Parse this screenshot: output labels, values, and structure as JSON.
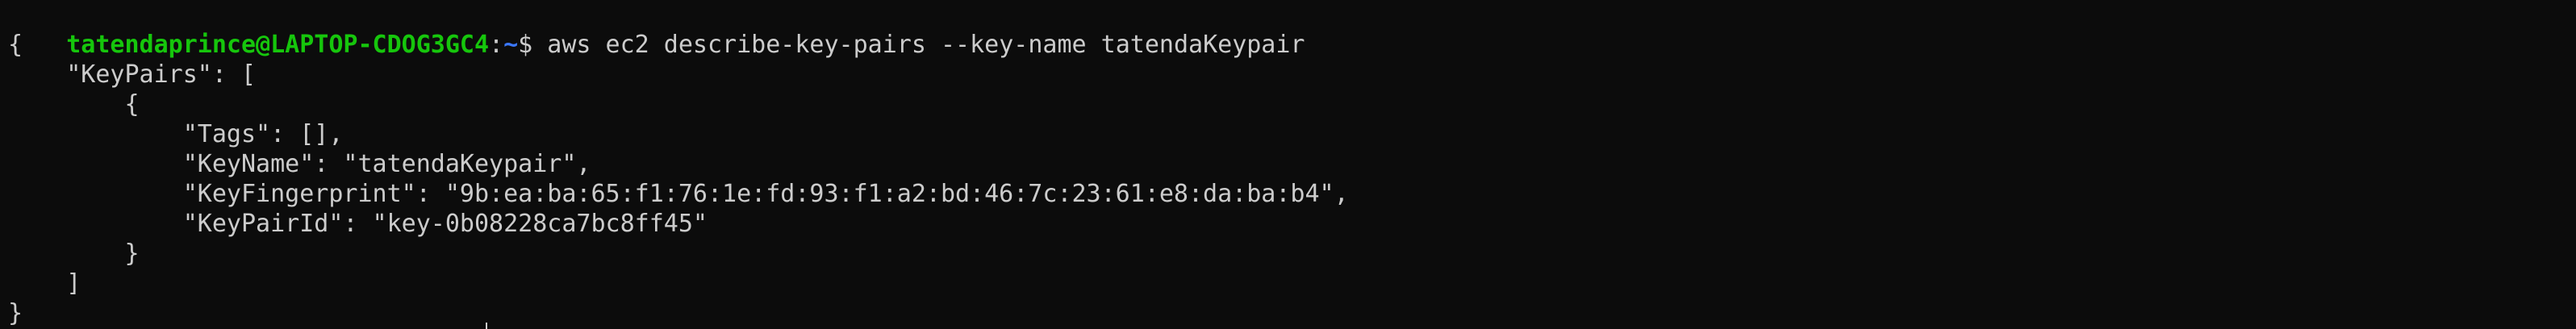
{
  "prompt": {
    "user_host": "tatendaprince@LAPTOP-CDOG3GC4",
    "separator": ":",
    "cwd": "~",
    "symbol": "$ ",
    "command": "aws ec2 describe-key-pairs --key-name tatendaKeypair"
  },
  "output": {
    "lines": [
      "{",
      "    \"KeyPairs\": [",
      "        {",
      "            \"Tags\": [],",
      "            \"KeyName\": \"tatendaKeypair\",",
      "            \"KeyFingerprint\": \"9b:ea:ba:65:f1:76:1e:fd:93:f1:a2:bd:46:7c:23:61:e8:da:ba:b4\",",
      "            \"KeyPairId\": \"key-0b08228ca7bc8ff45\"",
      "        }",
      "    ]",
      "}"
    ]
  },
  "colors": {
    "background": "#0c0c0c",
    "text": "#cccccc",
    "user_host": "#16c60c",
    "cwd": "#3b78ff"
  }
}
